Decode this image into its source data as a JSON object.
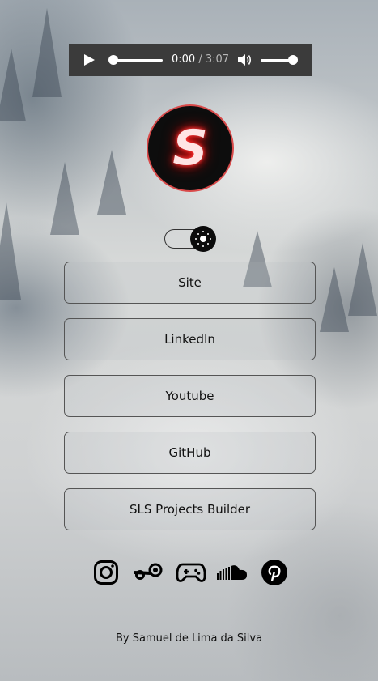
{
  "player": {
    "current_time": "0:00",
    "separator": " / ",
    "duration": "3:07",
    "progress": 0.0,
    "volume": 1.0
  },
  "logo": {
    "letter": "S",
    "glow_color": "#ff2a2a"
  },
  "theme_toggle": {
    "state": "light",
    "icon": "sun-icon"
  },
  "links": [
    {
      "label": "Site"
    },
    {
      "label": "LinkedIn"
    },
    {
      "label": "Youtube"
    },
    {
      "label": "GitHub"
    },
    {
      "label": "SLS Projects Builder"
    }
  ],
  "socials": [
    "instagram-icon",
    "steam-icon",
    "gamepad-icon",
    "soundcloud-icon",
    "pinterest-icon"
  ],
  "footer": {
    "text": "By Samuel de Lima da Silva"
  }
}
